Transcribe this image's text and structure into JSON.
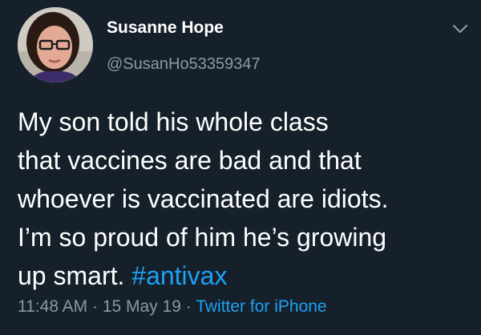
{
  "tweet": {
    "author": {
      "display_name": "Susanne Hope",
      "handle": "@SusanHo53359347"
    },
    "body_lines": [
      "My son told his whole class",
      "that vaccines are bad and that",
      "whoever is vaccinated are idiots.",
      "I’m so proud of him he’s growing",
      "up smart."
    ],
    "hashtag": "#antivax",
    "time": "11:48 AM",
    "separator": " · ",
    "date": "15 May 19",
    "source": "Twitter for iPhone"
  },
  "colors": {
    "background": "#15202b",
    "text_primary": "#ffffff",
    "text_secondary": "#8899a6",
    "accent": "#1da1f2"
  },
  "icons": {
    "menu": "chevron-down-icon"
  }
}
